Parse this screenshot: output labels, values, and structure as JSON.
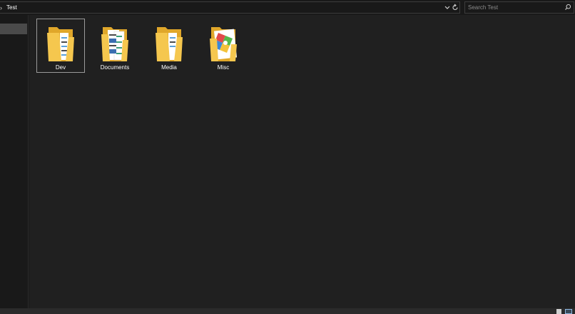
{
  "address": {
    "path": [
      "Test"
    ],
    "current": "Test"
  },
  "search": {
    "placeholder": "Search Test",
    "value": ""
  },
  "items": [
    {
      "name": "Dev",
      "icon": "folder-icon",
      "selected": true
    },
    {
      "name": "Documents",
      "icon": "folder-documents-icon",
      "selected": false
    },
    {
      "name": "Media",
      "icon": "folder-icon",
      "selected": false
    },
    {
      "name": "Misc",
      "icon": "folder-misc-icon",
      "selected": false
    }
  ],
  "colors": {
    "background": "#191919",
    "content_background": "#202020",
    "folder_yellow": "#f5c74e",
    "folder_dark": "#e0a72a",
    "selection_border": "#9a9a9a"
  }
}
